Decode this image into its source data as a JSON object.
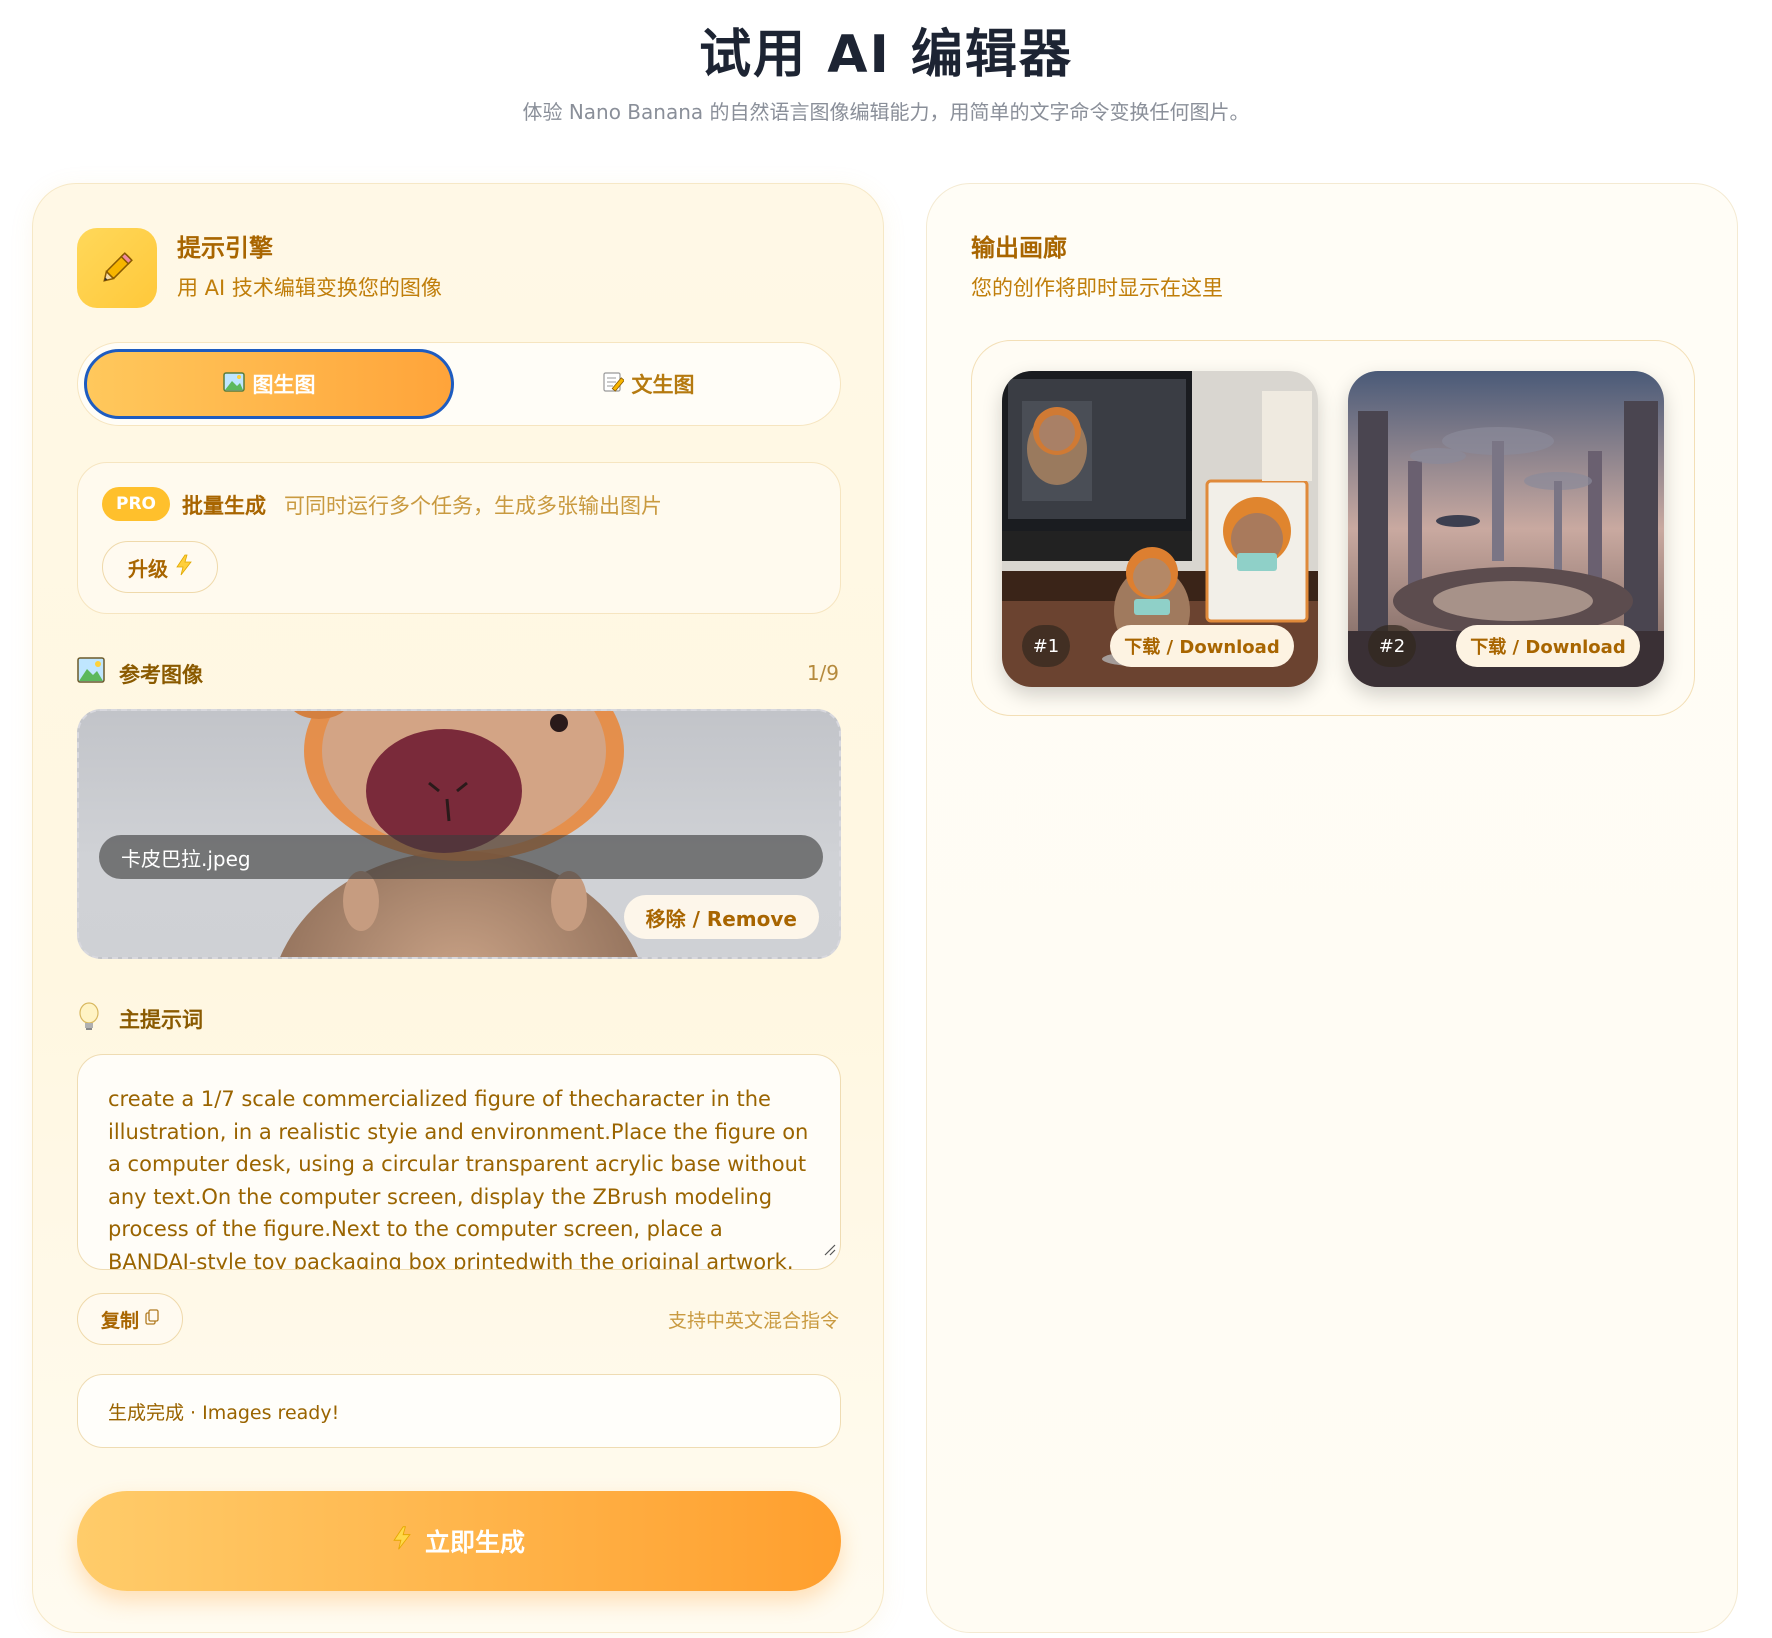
{
  "header": {
    "title": "试用 AI 编辑器",
    "subtitle": "体验 Nano Banana 的自然语言图像编辑能力，用简单的文字命令变换任何图片。"
  },
  "engine": {
    "title": "提示引擎",
    "subtitle": "用 AI 技术编辑变换您的图像",
    "icon": "pencil-icon"
  },
  "tabs": [
    {
      "label": "图生图",
      "icon": "image-icon",
      "active": true
    },
    {
      "label": "文生图",
      "icon": "memo-icon",
      "active": false
    }
  ],
  "pro": {
    "badge": "PRO",
    "title": "批量生成",
    "description": "可同时运行多个任务，生成多张输出图片",
    "upgrade_label": "升级",
    "upgrade_icon": "lightning-icon"
  },
  "reference": {
    "title": "参考图像",
    "count": "1/9",
    "filename": "卡皮巴拉.jpeg",
    "remove_label": "移除 / Remove"
  },
  "prompt": {
    "label": "主提示词",
    "text": "create a 1/7 scale commercialized figure of thecharacter in the illustration, in a realistic styie and environment.Place the figure on a computer desk, using a circular transparent acrylic base without any text.On the computer screen, display the ZBrush modeling process of the figure.Next to the computer screen, place a BANDAI-style toy packaging box printedwith the original artwork.",
    "copy_label": "复制",
    "hint": "支持中英文混合指令"
  },
  "status": {
    "text": "生成完成 · Images ready!"
  },
  "generate": {
    "label": "立即生成"
  },
  "gallery": {
    "title": "输出画廊",
    "subtitle": "您的创作将即时显示在这里",
    "items": [
      {
        "number": "#1",
        "download_label": "下载 / Download"
      },
      {
        "number": "#2",
        "download_label": "下载 / Download"
      }
    ]
  },
  "colors": {
    "accent": "#ffa43a",
    "brand_text": "#a86500",
    "tab_outline": "#1e5cc0"
  }
}
